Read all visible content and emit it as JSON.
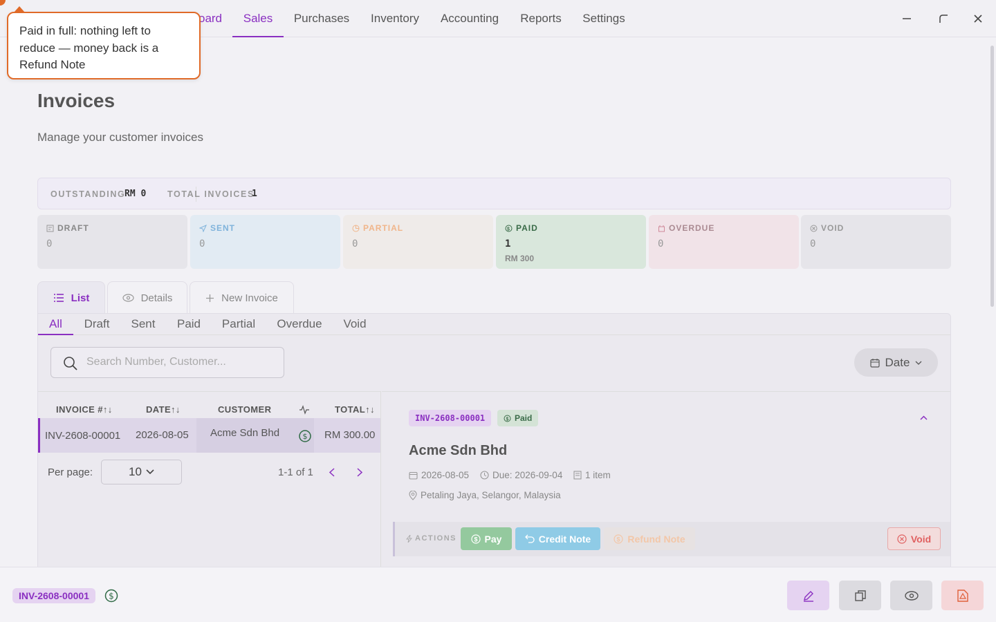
{
  "nav": {
    "items": [
      {
        "label": "Dashboard",
        "visible_label": "oard"
      },
      {
        "label": "Sales"
      },
      {
        "label": "Purchases"
      },
      {
        "label": "Inventory"
      },
      {
        "label": "Accounting"
      },
      {
        "label": "Reports"
      },
      {
        "label": "Settings"
      }
    ],
    "active": "Sales"
  },
  "tooltip": {
    "text": "Paid in full: nothing left to reduce — money back is a Refund Note"
  },
  "page": {
    "title": "Invoices",
    "subtitle": "Manage your customer invoices"
  },
  "summary": {
    "outstanding_label": "OUTSTANDING",
    "outstanding_value": "RM 0",
    "total_label": "TOTAL INVOICES",
    "total_value": "1"
  },
  "status_cards": [
    {
      "label": "DRAFT",
      "count": "0",
      "amount": "",
      "color": "#888888",
      "bg": "#e6e5ea"
    },
    {
      "label": "SENT",
      "count": "0",
      "amount": "",
      "color": "#7fb3db",
      "bg": "#e2ebf3"
    },
    {
      "label": "PARTIAL",
      "count": "0",
      "amount": "",
      "color": "#f0b58a",
      "bg": "#efebe9"
    },
    {
      "label": "PAID",
      "count": "1",
      "amount": "RM 300",
      "color": "#3a6b48",
      "bg": "#d9e7dc"
    },
    {
      "label": "OVERDUE",
      "count": "0",
      "amount": "",
      "color": "#aa8a92",
      "bg": "#f1e3e8"
    },
    {
      "label": "VOID",
      "count": "0",
      "amount": "",
      "color": "#999999",
      "bg": "#e6e5ea"
    }
  ],
  "tabs": {
    "list": "List",
    "details": "Details",
    "new_invoice": "New Invoice"
  },
  "filters": [
    "All",
    "Draft",
    "Sent",
    "Paid",
    "Partial",
    "Overdue",
    "Void"
  ],
  "search": {
    "placeholder": "Search Number, Customer..."
  },
  "date_button": "Date",
  "table": {
    "headers": {
      "invoice": "INVOICE #↑↓",
      "date": "DATE↑↓",
      "customer": "CUSTOMER",
      "total": "TOTAL↑↓"
    },
    "rows": [
      {
        "invoice": "INV-2608-00001",
        "date": "2026-08-05",
        "customer": "Acme Sdn Bhd",
        "total": "RM 300.00"
      }
    ]
  },
  "pagination": {
    "per_page_label": "Per page:",
    "per_page_value": "10",
    "range": "1-1 of 1"
  },
  "detail": {
    "invoice_number": "INV-2608-00001",
    "status": "Paid",
    "customer": "Acme Sdn Bhd",
    "date": "2026-08-05",
    "due": "Due: 2026-09-04",
    "items": "1 item",
    "location": "Petaling Jaya, Selangor, Malaysia"
  },
  "actions": {
    "label": "ACTIONS",
    "pay": "Pay",
    "credit_note": "Credit Note",
    "refund_note": "Refund Note",
    "void": "Void"
  },
  "footer": {
    "invoice_number": "INV-2608-00001"
  },
  "colors": {
    "accent": "#8a2fc1",
    "tooltip_border": "#e06a28",
    "pay_green": "#94c99e",
    "credit_blue": "#8fcbe6",
    "void_red": "#e06060"
  }
}
